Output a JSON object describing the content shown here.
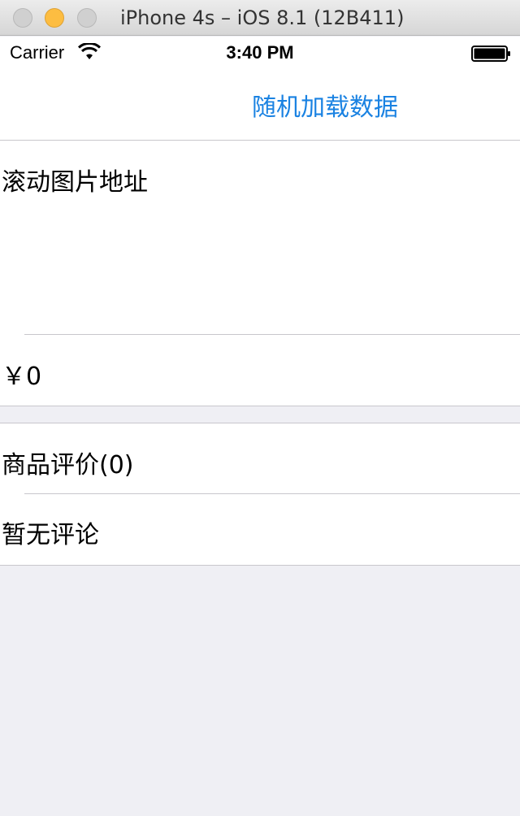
{
  "window": {
    "title": "iPhone 4s – iOS 8.1 (12B411)"
  },
  "status_bar": {
    "carrier": "Carrier",
    "time": "3:40 PM"
  },
  "nav_bar": {
    "right_button_label": "随机加载数据",
    "tint_color": "#1a82e2"
  },
  "product_section": {
    "image_url_label": "滚动图片地址",
    "price": "￥0"
  },
  "reviews_section": {
    "reviews_header": "商品评价(0)",
    "empty_message": "暂无评论"
  }
}
